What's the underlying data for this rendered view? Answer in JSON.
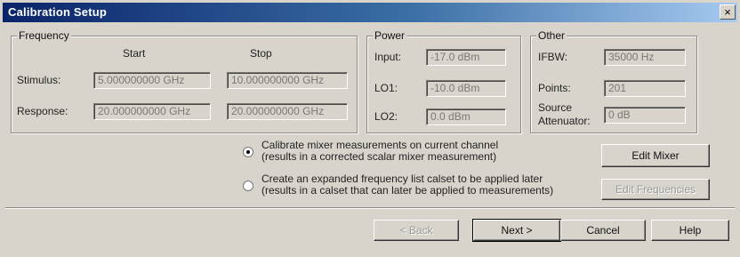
{
  "dialog": {
    "title": "Calibration Setup",
    "close_glyph": "×"
  },
  "frequency": {
    "legend": "Frequency",
    "col_start": "Start",
    "col_stop": "Stop",
    "stimulus_label": "Stimulus:",
    "response_label": "Response:",
    "stimulus_start": "5.000000000 GHz",
    "stimulus_stop": "10.000000000 GHz",
    "response_start": "20.000000000 GHz",
    "response_stop": "20.000000000 GHz"
  },
  "power": {
    "legend": "Power",
    "input_label": "Input:",
    "input_value": "-17.0 dBm",
    "lo1_label": "LO1:",
    "lo1_value": "-10.0 dBm",
    "lo2_label": "LO2:",
    "lo2_value": "0.0 dBm"
  },
  "other": {
    "legend": "Other",
    "ifbw_label": "IFBW:",
    "ifbw_value": "35000 Hz",
    "points_label": "Points:",
    "points_value": "201",
    "atten_label_1": "Source",
    "atten_label_2": "Attenuator:",
    "atten_value": "0 dB"
  },
  "options": {
    "opt1_line1": "Calibrate mixer measurements on current channel",
    "opt1_line2": "(results in a corrected scalar mixer measurement)",
    "opt2_line1": "Create an expanded frequency list calset to be applied later",
    "opt2_line2": "(results in a calset that can later be applied to measurements)",
    "selected": "opt1"
  },
  "buttons": {
    "edit_mixer": "Edit Mixer",
    "edit_frequencies": "Edit Frequencies",
    "back": "< Back",
    "next": "Next >",
    "cancel": "Cancel",
    "help": "Help"
  }
}
